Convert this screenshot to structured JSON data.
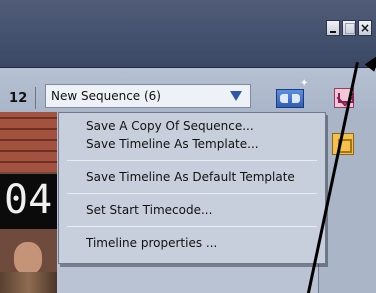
{
  "window_controls": {
    "minimize_label": "",
    "maximize_label": "",
    "close_label": "×"
  },
  "toolbar": {
    "timecode_fragment": "12",
    "sequence_select": {
      "value": "New Sequence (6)"
    }
  },
  "video_preview": {
    "overlay_digits": "04"
  },
  "context_menu": {
    "groups": [
      [
        "Save A Copy Of Sequence...",
        "Save Timeline As Template..."
      ],
      [
        "Save Timeline As Default Template"
      ],
      [
        "Set Start Timecode..."
      ],
      [
        "Timeline properties ..."
      ]
    ]
  },
  "icons": {
    "snap": "snap-icon",
    "marker": "marker-icon",
    "panel_action": "panel-icon",
    "dropdown": "chevron-down-icon"
  },
  "colors": {
    "accent_blue": "#2f57a8",
    "marker_pink": "#f2c7d8",
    "panel_yellow": "#f4c14e"
  }
}
